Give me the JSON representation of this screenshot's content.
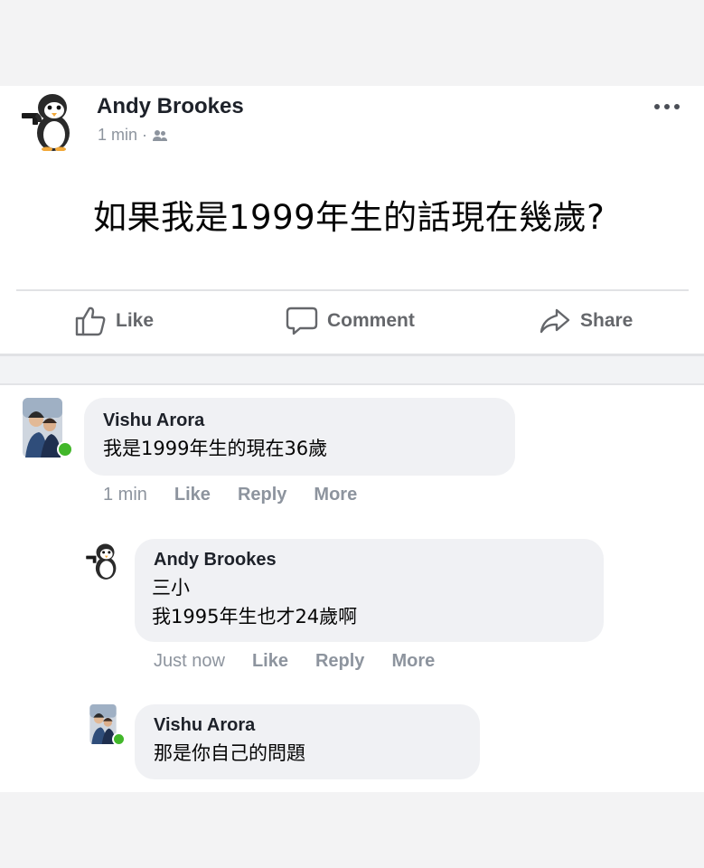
{
  "post": {
    "author": "Andy Brookes",
    "time": "1 min",
    "separator": "·",
    "text": "如果我是1999年生的話現在幾歲?"
  },
  "actions": {
    "like": "Like",
    "comment": "Comment",
    "share": "Share"
  },
  "comments": [
    {
      "author": "Vishu Arora",
      "lines": [
        "我是1999年生的現在36歲"
      ],
      "time": "1 min",
      "like": "Like",
      "reply": "Reply",
      "more": "More"
    },
    {
      "author": "Andy Brookes",
      "lines": [
        "三小",
        "我1995年生也才24歲啊"
      ],
      "time": "Just now",
      "like": "Like",
      "reply": "Reply",
      "more": "More"
    },
    {
      "author": "Vishu Arora",
      "lines": [
        "那是你自己的問題"
      ]
    }
  ],
  "colors": {
    "secondary_text": "#8d949e",
    "action_text": "#65676b",
    "bubble": "#f0f1f4",
    "online": "#42b72a"
  },
  "icons": [
    "penguin-gun-avatar",
    "audience-friends-icon",
    "more-dots-icon",
    "like-thumb-icon",
    "comment-bubble-icon",
    "share-arrow-icon",
    "couple-photo-avatar"
  ]
}
